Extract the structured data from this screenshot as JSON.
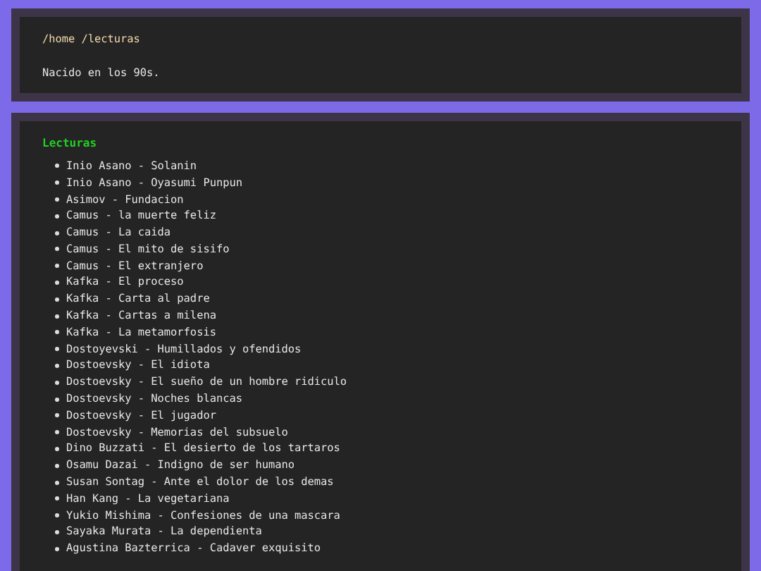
{
  "header": {
    "path": "/home /lecturas",
    "tagline": "Nacido en los 90s."
  },
  "readings": {
    "title": "Lecturas",
    "items": [
      "Inio Asano - Solanin",
      "Inio Asano - Oyasumi Punpun",
      "Asimov - Fundacion",
      "Camus - la muerte feliz",
      "Camus - La caida",
      "Camus - El mito de sisifo",
      "Camus - El extranjero",
      "Kafka - El proceso",
      "Kafka - Carta al padre",
      "Kafka - Cartas a milena",
      "Kafka - La metamorfosis",
      "Dostoyevski - Humillados y ofendidos",
      "Dostoevsky - El idiota",
      "Dostoevsky - El sueño de un hombre ridiculo",
      "Dostoevsky - Noches blancas",
      "Dostoevsky - El jugador",
      "Dostoevsky - Memorias del subsuelo",
      "Dino Buzzati - El desierto de los tartaros",
      "Osamu Dazai - Indigno de ser humano",
      "Susan Sontag - Ante el dolor de los demas",
      "Han Kang - La vegetariana",
      "Yukio Mishima - Confesiones de una mascara",
      "Sayaka Murata - La dependienta",
      "Agustina Bazterrica - Cadaver exquisito"
    ]
  }
}
